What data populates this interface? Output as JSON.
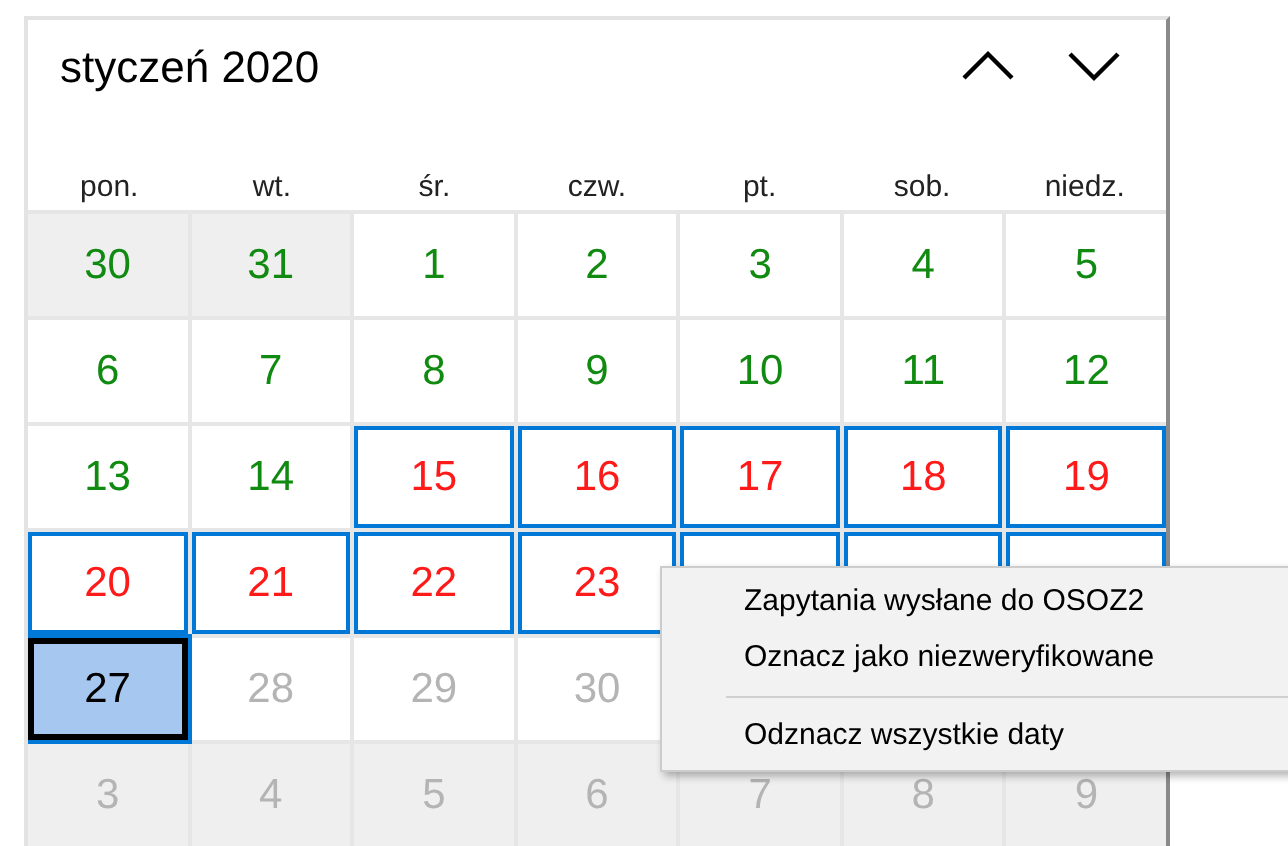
{
  "calendar": {
    "title": "styczeń 2020",
    "weekdays": [
      "pon.",
      "wt.",
      "śr.",
      "czw.",
      "pt.",
      "sob.",
      "niedz."
    ],
    "weeks": [
      [
        {
          "day": "30",
          "color": "#108a10",
          "other_month": true,
          "selected": false
        },
        {
          "day": "31",
          "color": "#108a10",
          "other_month": true,
          "selected": false
        },
        {
          "day": "1",
          "color": "#108a10",
          "other_month": false,
          "selected": false
        },
        {
          "day": "2",
          "color": "#108a10",
          "other_month": false,
          "selected": false
        },
        {
          "day": "3",
          "color": "#108a10",
          "other_month": false,
          "selected": false
        },
        {
          "day": "4",
          "color": "#108a10",
          "other_month": false,
          "selected": false
        },
        {
          "day": "5",
          "color": "#108a10",
          "other_month": false,
          "selected": false
        }
      ],
      [
        {
          "day": "6",
          "color": "#108a10",
          "other_month": false,
          "selected": false
        },
        {
          "day": "7",
          "color": "#108a10",
          "other_month": false,
          "selected": false
        },
        {
          "day": "8",
          "color": "#108a10",
          "other_month": false,
          "selected": false
        },
        {
          "day": "9",
          "color": "#108a10",
          "other_month": false,
          "selected": false
        },
        {
          "day": "10",
          "color": "#108a10",
          "other_month": false,
          "selected": false
        },
        {
          "day": "11",
          "color": "#108a10",
          "other_month": false,
          "selected": false
        },
        {
          "day": "12",
          "color": "#108a10",
          "other_month": false,
          "selected": false
        }
      ],
      [
        {
          "day": "13",
          "color": "#108a10",
          "other_month": false,
          "selected": false
        },
        {
          "day": "14",
          "color": "#108a10",
          "other_month": false,
          "selected": false
        },
        {
          "day": "15",
          "color": "#ff1a1a",
          "other_month": false,
          "selected": true
        },
        {
          "day": "16",
          "color": "#ff1a1a",
          "other_month": false,
          "selected": true
        },
        {
          "day": "17",
          "color": "#ff1a1a",
          "other_month": false,
          "selected": true
        },
        {
          "day": "18",
          "color": "#ff1a1a",
          "other_month": false,
          "selected": true
        },
        {
          "day": "19",
          "color": "#ff1a1a",
          "other_month": false,
          "selected": true
        }
      ],
      [
        {
          "day": "20",
          "color": "#ff1a1a",
          "other_month": false,
          "selected": true
        },
        {
          "day": "21",
          "color": "#ff1a1a",
          "other_month": false,
          "selected": true
        },
        {
          "day": "22",
          "color": "#ff1a1a",
          "other_month": false,
          "selected": true
        },
        {
          "day": "23",
          "color": "#ff1a1a",
          "other_month": false,
          "selected": true
        },
        {
          "other_month": false,
          "selected": true
        },
        {
          "other_month": false,
          "selected": true
        },
        {
          "other_month": false,
          "selected": true
        }
      ],
      [
        {
          "day": "27",
          "color": "#000000",
          "other_month": false,
          "selected": true,
          "today": true
        },
        {
          "day": "28",
          "color": "#b4b4b4",
          "other_month": false,
          "selected": false
        },
        {
          "day": "29",
          "color": "#b4b4b4",
          "other_month": false,
          "selected": false
        },
        {
          "day": "30",
          "color": "#b4b4b4",
          "other_month": false,
          "selected": false
        }
      ],
      [
        {
          "day": "3",
          "color": "#b4b4b4",
          "other_month": true,
          "selected": false
        },
        {
          "day": "4",
          "color": "#b4b4b4",
          "other_month": true,
          "selected": false
        },
        {
          "day": "5",
          "color": "#b4b4b4",
          "other_month": true,
          "selected": false
        },
        {
          "day": "6",
          "color": "#b4b4b4",
          "other_month": true,
          "selected": false
        },
        {
          "day": "7",
          "color": "#b4b4b4",
          "other_month": true,
          "selected": false
        },
        {
          "day": "8",
          "color": "#b4b4b4",
          "other_month": true,
          "selected": false
        },
        {
          "day": "9",
          "color": "#b4b4b4",
          "other_month": true,
          "selected": false
        }
      ]
    ]
  },
  "context_menu": {
    "items": [
      {
        "kind": "item",
        "label": "Zapytania wysłane do OSOZ2"
      },
      {
        "kind": "item",
        "label": "Oznacz jako niezweryfikowane"
      },
      {
        "kind": "separator"
      },
      {
        "kind": "item",
        "label": "Odznacz wszystkie daty"
      }
    ]
  }
}
